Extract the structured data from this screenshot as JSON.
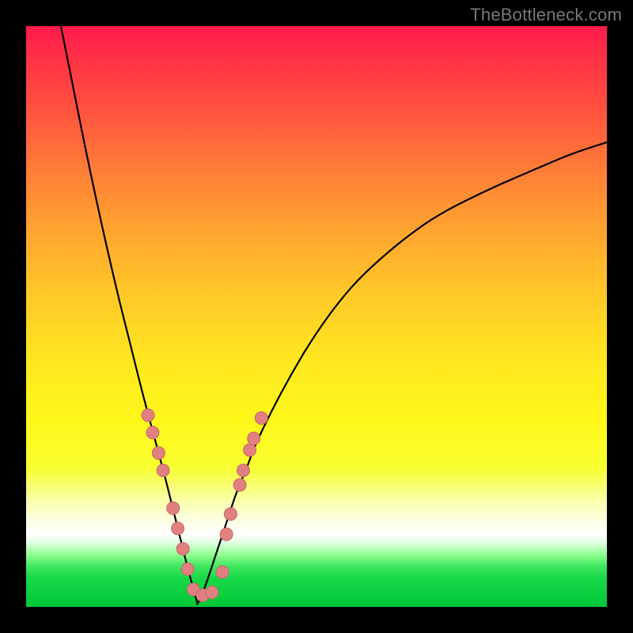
{
  "watermark": "TheBottleneck.com",
  "colors": {
    "frame": "#000000",
    "curve": "#000000",
    "marker_fill": "#e08080",
    "marker_stroke": "#c86868",
    "gradient_stops": [
      {
        "pct": 0,
        "hex": "#ff1a4d"
      },
      {
        "pct": 6,
        "hex": "#ff3344"
      },
      {
        "pct": 14,
        "hex": "#ff5040"
      },
      {
        "pct": 24,
        "hex": "#ff7a38"
      },
      {
        "pct": 34,
        "hex": "#ffa030"
      },
      {
        "pct": 46,
        "hex": "#ffc828"
      },
      {
        "pct": 58,
        "hex": "#ffe820"
      },
      {
        "pct": 68,
        "hex": "#fff81a"
      },
      {
        "pct": 76,
        "hex": "#f8ff30"
      },
      {
        "pct": 82,
        "hex": "#faffb0"
      },
      {
        "pct": 85.5,
        "hex": "#fdffe8"
      },
      {
        "pct": 87.5,
        "hex": "#ffffff"
      },
      {
        "pct": 89,
        "hex": "#dfffe0"
      },
      {
        "pct": 91,
        "hex": "#90ff90"
      },
      {
        "pct": 93,
        "hex": "#40e860"
      },
      {
        "pct": 95,
        "hex": "#18d848"
      },
      {
        "pct": 100,
        "hex": "#00c838"
      }
    ]
  },
  "chart_data": {
    "type": "line",
    "title": "",
    "xlabel": "",
    "ylabel": "",
    "xlim": [
      0,
      100
    ],
    "ylim": [
      0,
      100
    ],
    "x_min_at": 29.5,
    "description": "V-shaped deviation curve. Left branch descends steeply from top-left to a minimum near x≈29.5 at y≈0, then a right branch rises with decreasing slope toward the right edge reaching y≈80 at x=100.",
    "series": [
      {
        "name": "left-branch",
        "x": [
          6,
          8,
          10,
          12,
          14,
          16,
          18,
          20,
          22,
          24,
          26,
          27,
          28,
          29,
          29.5
        ],
        "y": [
          100,
          90,
          80,
          70.5,
          61.5,
          53,
          45,
          37,
          29.5,
          22,
          14,
          10,
          6,
          2.5,
          0.5
        ]
      },
      {
        "name": "right-branch",
        "x": [
          29.5,
          30,
          31,
          32,
          33,
          34,
          36,
          38,
          40,
          44,
          48,
          52,
          56,
          60,
          66,
          72,
          80,
          88,
          94,
          100
        ],
        "y": [
          0.5,
          1.5,
          4,
          7,
          10,
          13,
          19,
          24,
          29,
          37,
          44,
          50,
          55,
          59,
          64,
          68,
          72,
          75.5,
          78,
          80
        ]
      }
    ],
    "markers": {
      "name": "highlighted-points",
      "radius_px": 8,
      "points": [
        {
          "x": 21.0,
          "y": 33.0
        },
        {
          "x": 21.8,
          "y": 30.0
        },
        {
          "x": 22.8,
          "y": 26.5
        },
        {
          "x": 23.6,
          "y": 23.5
        },
        {
          "x": 25.3,
          "y": 17.0
        },
        {
          "x": 26.1,
          "y": 13.5
        },
        {
          "x": 27.0,
          "y": 10.0
        },
        {
          "x": 27.8,
          "y": 6.5
        },
        {
          "x": 28.8,
          "y": 3.0
        },
        {
          "x": 30.4,
          "y": 2.0
        },
        {
          "x": 32.0,
          "y": 2.5
        },
        {
          "x": 33.8,
          "y": 6.0
        },
        {
          "x": 34.5,
          "y": 12.5
        },
        {
          "x": 35.2,
          "y": 16.0
        },
        {
          "x": 36.8,
          "y": 21.0
        },
        {
          "x": 37.4,
          "y": 23.5
        },
        {
          "x": 38.5,
          "y": 27.0
        },
        {
          "x": 39.2,
          "y": 29.0
        },
        {
          "x": 40.5,
          "y": 32.5
        }
      ]
    }
  }
}
